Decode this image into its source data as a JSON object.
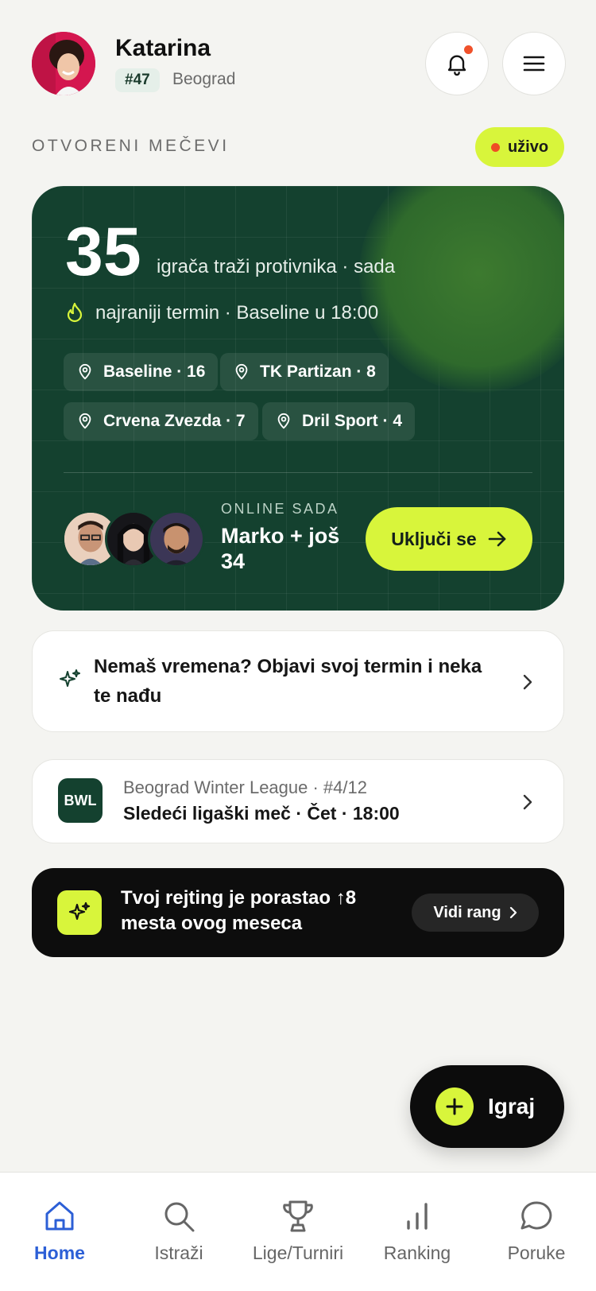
{
  "header": {
    "user_name": "Katarina",
    "rank": "#47",
    "city": "Beograd",
    "icons": [
      "bell-icon",
      "menu-icon"
    ]
  },
  "section": {
    "title": "OTVORENI MEČEVI",
    "live_label": "uživo"
  },
  "hero": {
    "count": "35",
    "count_subtitle": "igrača traži protivnika · sada",
    "earliest": "najraniji termin · Baseline u 18:00",
    "clubs": [
      {
        "label": "Baseline · 16"
      },
      {
        "label": "TK Partizan · 8"
      },
      {
        "label": "Crvena Zvezda · 7"
      },
      {
        "label": "Dril Sport · 4"
      }
    ],
    "online_label": "ONLINE SADA",
    "online_names": "Marko + još 34",
    "join_label": "Uključi se"
  },
  "post_card": {
    "text": "Nemaš vremena? Objavi svoj termin i neka te nađu"
  },
  "league_card": {
    "badge": "BWL",
    "line1": "Beograd Winter League · #4/12",
    "line2": "Sledeći ligaški meč · Čet · 18:00"
  },
  "rating_card": {
    "text": "Tvoj rejting je porastao ↑8 mesta ovog meseca",
    "button_label": "Vidi rang"
  },
  "fab": {
    "label": "Igraj"
  },
  "nav": {
    "items": [
      {
        "label": "Home",
        "icon": "home-icon",
        "active": true
      },
      {
        "label": "Istraži",
        "icon": "search-icon",
        "active": false
      },
      {
        "label": "Lige/Turniri",
        "icon": "trophy-icon",
        "active": false
      },
      {
        "label": "Ranking",
        "icon": "bar-chart-icon",
        "active": false
      },
      {
        "label": "Poruke",
        "icon": "chat-icon",
        "active": false
      }
    ]
  },
  "colors": {
    "accent_lime": "#d8f53b",
    "hero_green": "#14412f",
    "active_blue": "#2c5fd6",
    "live_dot": "#ef4e24"
  }
}
